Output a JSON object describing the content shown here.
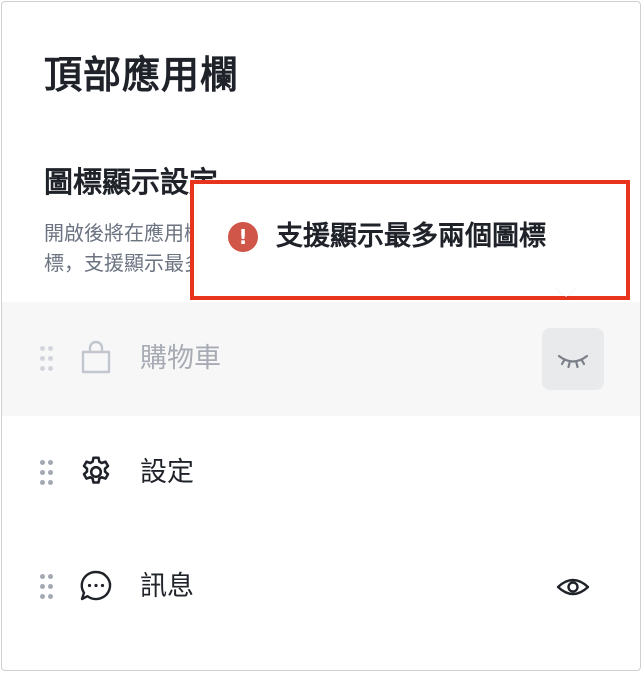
{
  "page": {
    "title": "頂部應用欄"
  },
  "section": {
    "title": "圖標顯示設定",
    "description_line1": "開啟後將在應用欄",
    "description_line2": "標，支援顯示最多"
  },
  "tooltip": {
    "text": "支援顯示最多兩個圖標",
    "icon": "alert-circle-icon",
    "highlight_color": "#e8341c",
    "icon_color": "#cf5648"
  },
  "items": [
    {
      "label": "購物車",
      "icon": "shopping-bag-icon",
      "visible": false,
      "disabled": true
    },
    {
      "label": "設定",
      "icon": "gear-icon",
      "visible": false,
      "disabled": false
    },
    {
      "label": "訊息",
      "icon": "chat-bubble-icon",
      "visible": true,
      "disabled": false
    }
  ],
  "colors": {
    "text_primary": "#1f2329",
    "text_secondary": "#6b7280",
    "disabled_row_bg": "#f7f7f8"
  }
}
